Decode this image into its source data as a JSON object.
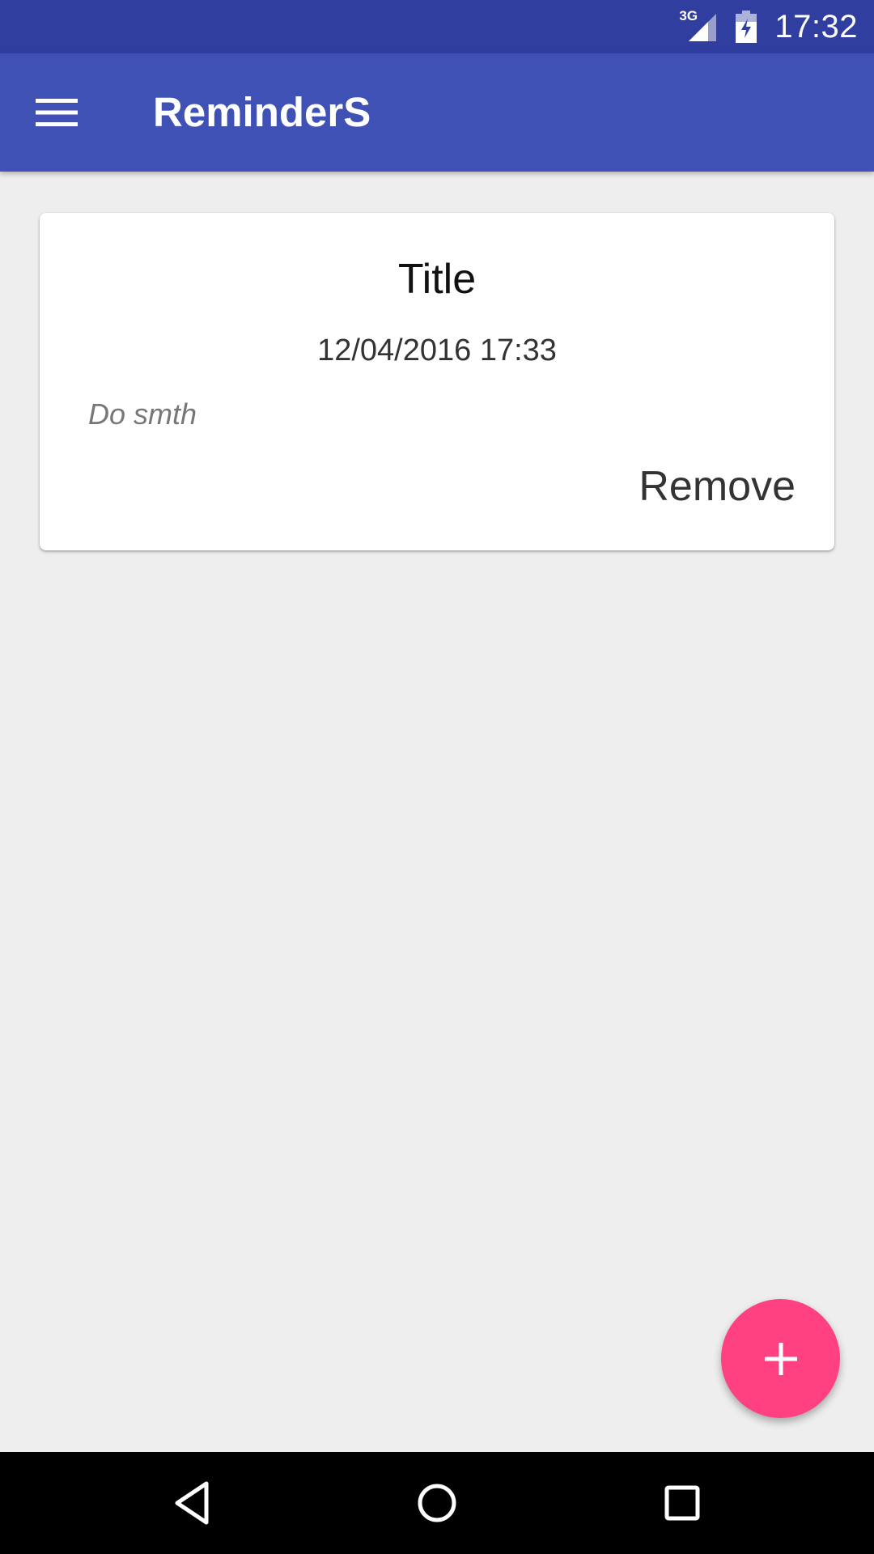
{
  "status_bar": {
    "network_type": "3G",
    "time": "17:32",
    "icons": [
      "signal-icon",
      "battery-charging-icon"
    ]
  },
  "app_bar": {
    "title": "ReminderS",
    "menu_icon": "hamburger-menu-icon"
  },
  "reminders": [
    {
      "title": "Title",
      "datetime": "12/04/2016 17:33",
      "body": "Do smth",
      "remove_label": "Remove"
    }
  ],
  "fab": {
    "icon": "plus-icon"
  },
  "nav_bar": {
    "icons": [
      "back-icon",
      "home-icon",
      "recents-icon"
    ]
  },
  "colors": {
    "status_bar": "#303F9F",
    "app_bar": "#3F51B5",
    "background": "#EEEEEE",
    "card": "#FFFFFF",
    "fab": "#FF4081",
    "nav_bar": "#000000"
  }
}
